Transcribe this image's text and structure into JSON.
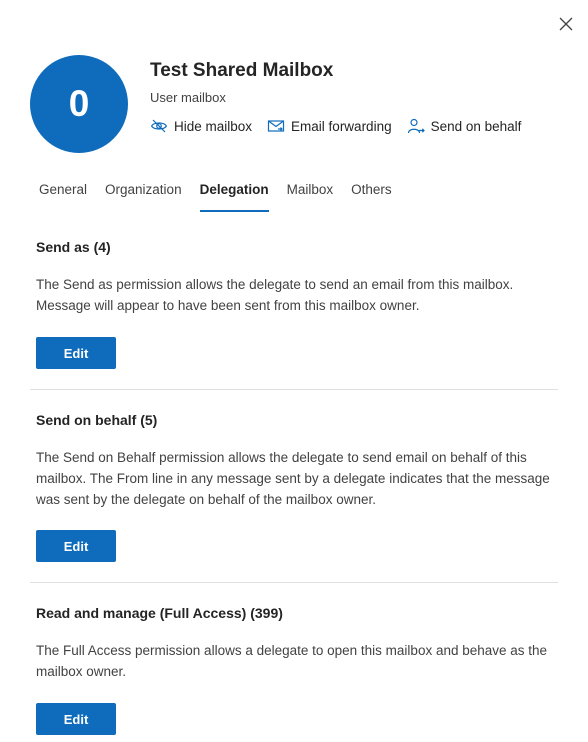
{
  "panel": {
    "close_icon": "close-icon"
  },
  "header": {
    "avatar_initial": "0",
    "avatar_color": "#0f6cbd",
    "title": "Test Shared Mailbox",
    "subtitle": "User mailbox",
    "actions": [
      {
        "label": "Hide mailbox",
        "icon": "hide-icon"
      },
      {
        "label": "Email forwarding",
        "icon": "mail-forward-icon"
      },
      {
        "label": "Send on behalf",
        "icon": "person-arrow-icon"
      }
    ]
  },
  "tabs": [
    {
      "label": "General",
      "active": false
    },
    {
      "label": "Organization",
      "active": false
    },
    {
      "label": "Delegation",
      "active": true
    },
    {
      "label": "Mailbox",
      "active": false
    },
    {
      "label": "Others",
      "active": false
    }
  ],
  "sections": [
    {
      "heading": "Send as (4)",
      "description": "The Send as permission allows the delegate to send an email from this mailbox. Message will appear to have been sent from this mailbox owner.",
      "button": "Edit"
    },
    {
      "heading": "Send on behalf (5)",
      "description": "The Send on Behalf permission allows the delegate to send email on behalf of this mailbox. The From line in any message sent by a delegate indicates that the message was sent by the delegate on behalf of the mailbox owner.",
      "button": "Edit"
    },
    {
      "heading": "Read and manage (Full Access) (399)",
      "description": "The Full Access permission allows a delegate to open this mailbox and behave as the mailbox owner.",
      "button": "Edit"
    }
  ],
  "colors": {
    "accent": "#0f6cbd",
    "divider": "#e1dfdd"
  }
}
